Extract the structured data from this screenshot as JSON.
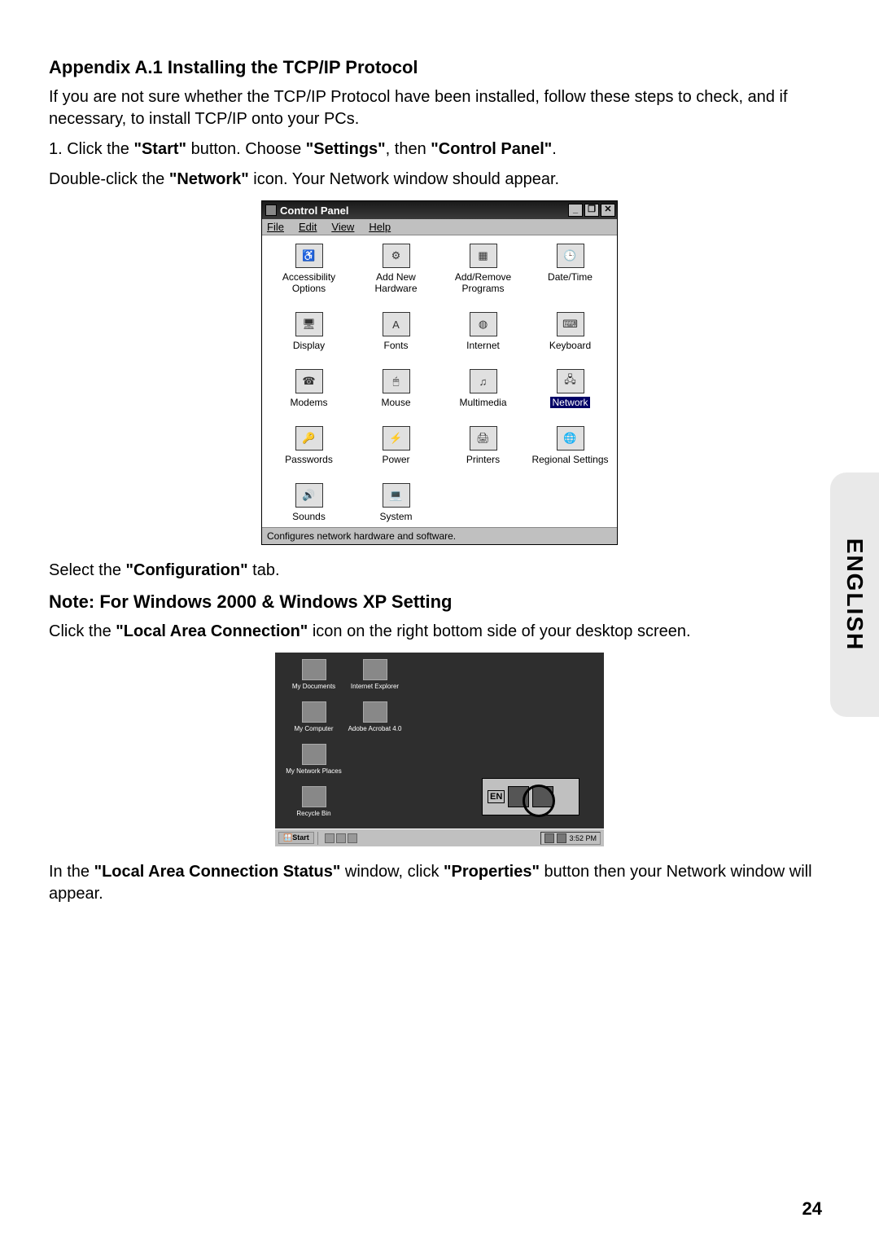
{
  "heading1": "Appendix A.1 Installing the TCP/IP Protocol",
  "intro": "If you are not sure whether the TCP/IP Protocol have been installed, follow these steps to check, and if necessary, to install TCP/IP onto your PCs.",
  "step1_pre": "1.  Click the ",
  "step1_b1": "\"Start\"",
  "step1_mid1": " button. Choose ",
  "step1_b2": "\"Settings\"",
  "step1_mid2": ", then ",
  "step1_b3": "\"Control Panel\"",
  "step1_end": ".",
  "line2_pre": "Double-click the ",
  "line2_b": "\"Network\"",
  "line2_end": " icon. Your Network window should appear.",
  "cp": {
    "title": "Control Panel",
    "btn_min": "_",
    "btn_max": "❐",
    "btn_close": "✕",
    "menu": {
      "file": "File",
      "edit": "Edit",
      "view": "View",
      "help": "Help",
      "file_u": "F",
      "edit_u": "E",
      "view_u": "V",
      "help_u": "H"
    },
    "items": [
      {
        "label": "Accessibility Options",
        "glyph": "♿"
      },
      {
        "label": "Add New Hardware",
        "glyph": "⚙"
      },
      {
        "label": "Add/Remove Programs",
        "glyph": "▦"
      },
      {
        "label": "Date/Time",
        "glyph": "🕒"
      },
      {
        "label": "Display",
        "glyph": "🖥"
      },
      {
        "label": "Fonts",
        "glyph": "A"
      },
      {
        "label": "Internet",
        "glyph": "◍"
      },
      {
        "label": "Keyboard",
        "glyph": "⌨"
      },
      {
        "label": "Modems",
        "glyph": "☎"
      },
      {
        "label": "Mouse",
        "glyph": "🖱"
      },
      {
        "label": "Multimedia",
        "glyph": "♫"
      },
      {
        "label": "Network",
        "glyph": "🖧",
        "selected": true
      },
      {
        "label": "Passwords",
        "glyph": "🔑"
      },
      {
        "label": "Power",
        "glyph": "⚡"
      },
      {
        "label": "Printers",
        "glyph": "🖨"
      },
      {
        "label": "Regional Settings",
        "glyph": "🌐"
      },
      {
        "label": "Sounds",
        "glyph": "🔊"
      },
      {
        "label": "System",
        "glyph": "💻"
      }
    ],
    "status": "Configures network hardware and software."
  },
  "select_pre": "Select the ",
  "select_b": "\"Configuration\"",
  "select_end": " tab.",
  "heading2": "Note: For Windows 2000 & Windows XP Setting",
  "line3_pre": "Click the ",
  "line3_b": "\"Local Area Connection\"",
  "line3_end": " icon on the right bottom side of your desktop screen.",
  "desktop": {
    "icons": [
      {
        "label": "My Documents"
      },
      {
        "label": "Internet Explorer"
      },
      {
        "label": "My Computer"
      },
      {
        "label": "Adobe Acrobat 4.0"
      },
      {
        "label": "My Network Places"
      },
      {
        "label": ""
      },
      {
        "label": "Recycle Bin"
      }
    ],
    "tray_lang": "EN",
    "start": "Start",
    "time": "3:52 PM"
  },
  "line4_pre": "In the ",
  "line4_b1": "\"Local Area Connection Status\"",
  "line4_mid": " window, click ",
  "line4_b2": "\"Properties\"",
  "line4_end": " button then your Network window will appear.",
  "side_tab": "ENGLISH",
  "page_num": "24"
}
